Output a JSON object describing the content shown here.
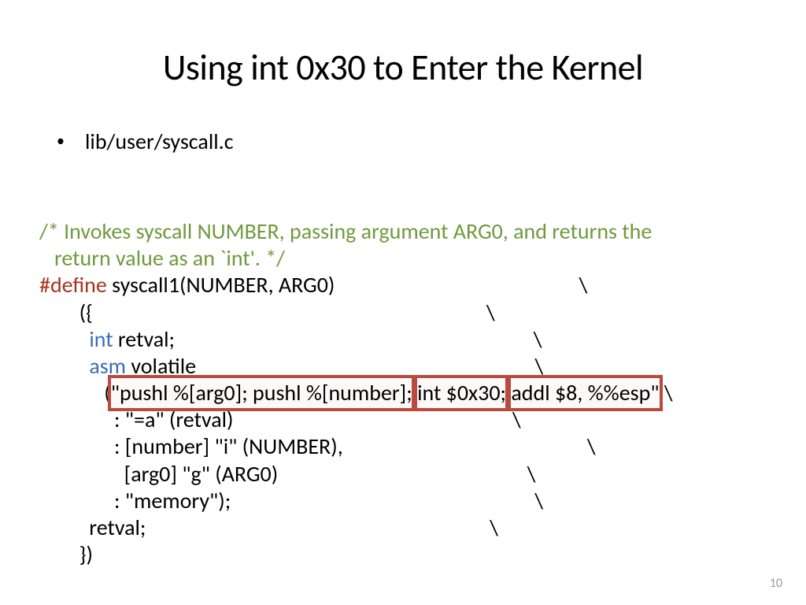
{
  "title": "Using int 0x30 to Enter the Kernel",
  "bullet": "lib/user/syscall.c",
  "comment_l1": "/* Invokes syscall NUMBER, passing argument ARG0, and returns the",
  "comment_l2": "   return value as an `int'. */",
  "define_kw": "#define",
  "define_rest": " syscall1(NUMBER, ARG0)                                                 \\",
  "line_open": "        ({                                                                               \\",
  "kw_int": "int",
  "int_rest": " retval;                                                                        \\",
  "kw_asm": "asm",
  "asm_rest": " volatile                                                                    \\",
  "asm_indent": "             (",
  "seg1": "\"pushl %[arg0]; pushl %[number];",
  "seg2": " int $0x30;",
  "seg3": " addl $8, %%esp\"",
  "asm_trail": " \\",
  "out_line": "               : \"=a\" (retval)                                                        \\",
  "in_line1": "               : [number] \"i\" (NUMBER),                                                 \\",
  "in_line2": "                 [arg0] \"g\" (ARG0)                                                  \\",
  "clob_line": "               : \"memory\");                                                             \\",
  "retval_line": "          retval;                                                                     \\",
  "close_line": "        })",
  "page": "10"
}
